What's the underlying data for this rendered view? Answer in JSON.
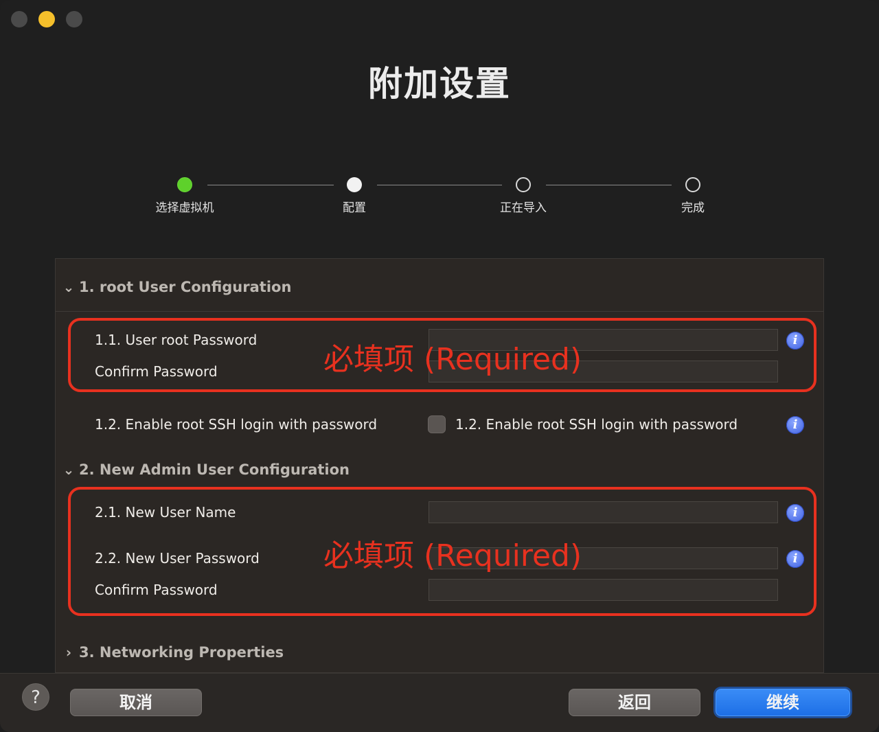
{
  "window": {
    "title": "附加设置"
  },
  "stepper": {
    "steps": [
      {
        "label": "选择虚拟机",
        "state": "done"
      },
      {
        "label": "配置",
        "state": "current"
      },
      {
        "label": "正在导入",
        "state": "todo"
      },
      {
        "label": "完成",
        "state": "todo"
      }
    ]
  },
  "sections": {
    "root": {
      "header": "1. root User Configuration",
      "expanded": true,
      "password_label": "1.1. User root Password",
      "confirm_label": "Confirm Password",
      "password_value": "",
      "confirm_value": "",
      "ssh_label": "1.2. Enable root SSH login with password",
      "ssh_checkbox_label": "1.2. Enable root SSH login with password",
      "ssh_enabled": false
    },
    "admin": {
      "header": "2. New Admin User Configuration",
      "expanded": true,
      "username_label": "2.1. New User Name",
      "password_label": "2.2. New User Password",
      "confirm_label": "Confirm Password",
      "username_value": "",
      "password_value": "",
      "confirm_value": ""
    },
    "network": {
      "header": "3. Networking Properties",
      "expanded": false
    }
  },
  "annotations": {
    "required_text": "必填项 (Required)",
    "color": "#e8311f"
  },
  "icons": {
    "info": "info-icon",
    "help": "?",
    "expanded": "chevron-down-icon",
    "collapsed": "chevron-right-icon"
  },
  "footer": {
    "help": "?",
    "cancel": "取消",
    "back": "返回",
    "continue": "继续"
  },
  "colors": {
    "accent": "#1d6fe6",
    "step_done": "#5ed12b",
    "info": "#3d5fe0"
  }
}
